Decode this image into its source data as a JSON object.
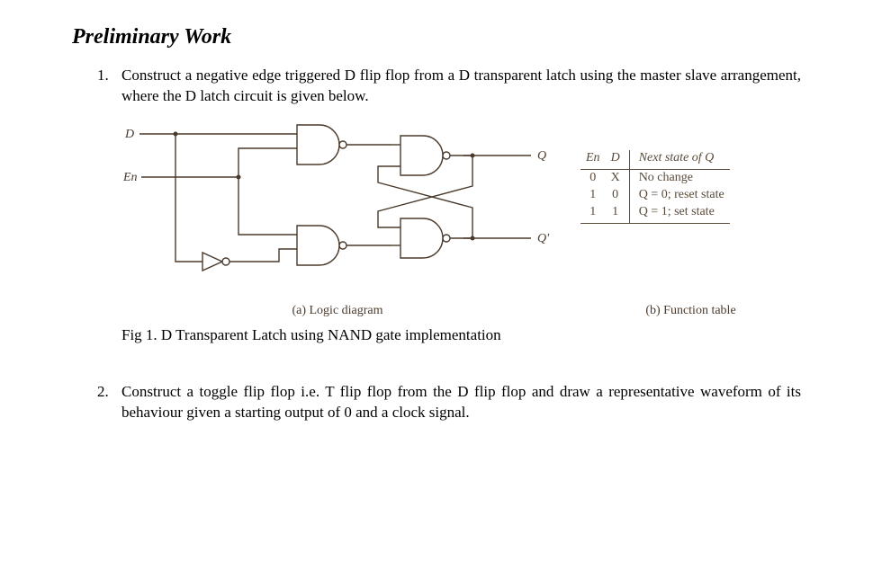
{
  "headingText": "Preliminary Work",
  "items": {
    "q1": "Construct a negative edge triggered D flip flop from a D transparent latch using the master slave arrangement, where the D latch circuit is given below.",
    "q2": "Construct a toggle flip flop i.e. T flip flop from the D flip flop and draw a representative waveform of its behaviour given a starting output of 0 and a clock signal."
  },
  "diagram": {
    "labels": {
      "D": "D",
      "En": "En",
      "Q": "Q",
      "Qprime": "Q'"
    }
  },
  "functionTable": {
    "headers": {
      "en": "En",
      "d": "D",
      "next": "Next state of Q"
    },
    "rows": [
      {
        "en": "0",
        "d": "X",
        "next": "No change"
      },
      {
        "en": "1",
        "d": "0",
        "next": "Q = 0; reset state"
      },
      {
        "en": "1",
        "d": "1",
        "next": "Q = 1; set state"
      }
    ]
  },
  "subcaptions": {
    "a": "(a) Logic diagram",
    "b": "(b) Function table"
  },
  "figCaption": "Fig 1. D Transparent Latch using NAND gate implementation"
}
